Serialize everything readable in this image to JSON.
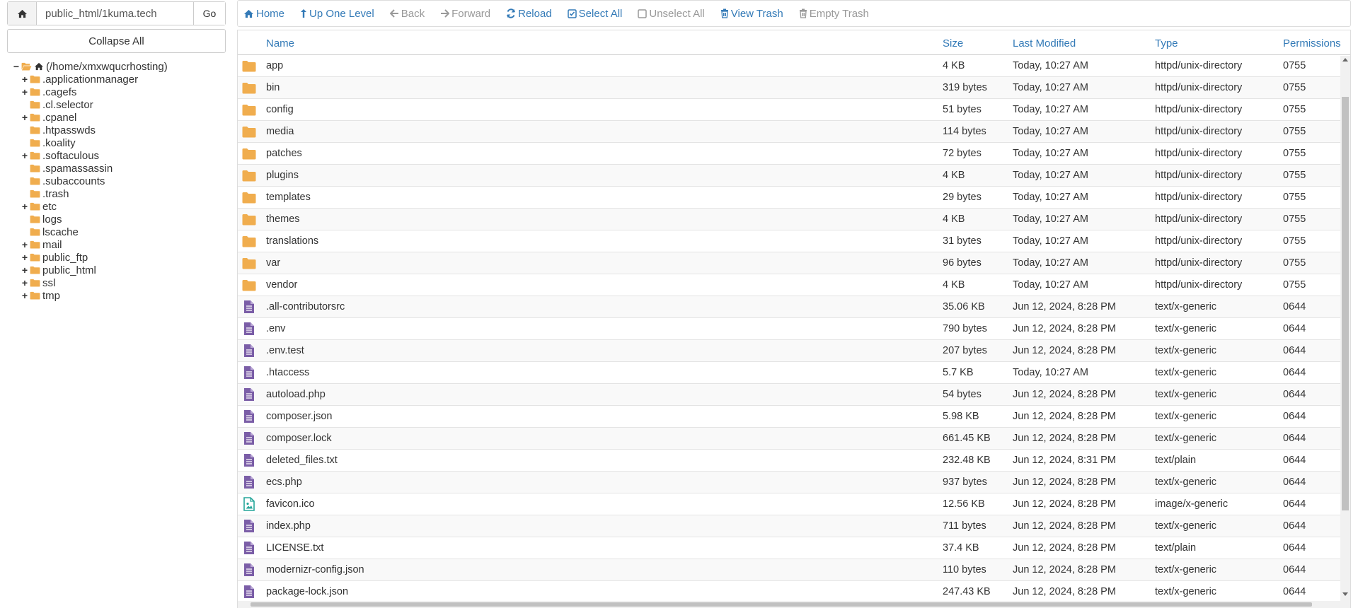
{
  "pathbar": {
    "home_icon": "home-icon",
    "path_value": "public_html/1kuma.tech",
    "go_label": "Go"
  },
  "collapse_label": "Collapse All",
  "tree": {
    "root": {
      "label": "(/home/xmxwqucrhosting)",
      "toggle": "−"
    },
    "items": [
      {
        "label": ".applicationmanager",
        "toggle": "+"
      },
      {
        "label": ".cagefs",
        "toggle": "+"
      },
      {
        "label": ".cl.selector",
        "toggle": ""
      },
      {
        "label": ".cpanel",
        "toggle": "+"
      },
      {
        "label": ".htpasswds",
        "toggle": ""
      },
      {
        "label": ".koality",
        "toggle": ""
      },
      {
        "label": ".softaculous",
        "toggle": "+"
      },
      {
        "label": ".spamassassin",
        "toggle": ""
      },
      {
        "label": ".subaccounts",
        "toggle": ""
      },
      {
        "label": ".trash",
        "toggle": ""
      },
      {
        "label": "etc",
        "toggle": "+"
      },
      {
        "label": "logs",
        "toggle": ""
      },
      {
        "label": "lscache",
        "toggle": ""
      },
      {
        "label": "mail",
        "toggle": "+"
      },
      {
        "label": "public_ftp",
        "toggle": "+"
      },
      {
        "label": "public_html",
        "toggle": "+"
      },
      {
        "label": "ssl",
        "toggle": "+"
      },
      {
        "label": "tmp",
        "toggle": "+"
      }
    ]
  },
  "toolbar": {
    "home": "Home",
    "up": "Up One Level",
    "back": "Back",
    "forward": "Forward",
    "reload": "Reload",
    "select_all": "Select All",
    "unselect_all": "Unselect All",
    "view_trash": "View Trash",
    "empty_trash": "Empty Trash"
  },
  "table": {
    "headers": {
      "name": "Name",
      "size": "Size",
      "modified": "Last Modified",
      "type": "Type",
      "perms": "Permissions"
    },
    "rows": [
      {
        "icon": "folder",
        "name": "app",
        "size": "4 KB",
        "modified": "Today, 10:27 AM",
        "type": "httpd/unix-directory",
        "perms": "0755"
      },
      {
        "icon": "folder",
        "name": "bin",
        "size": "319 bytes",
        "modified": "Today, 10:27 AM",
        "type": "httpd/unix-directory",
        "perms": "0755"
      },
      {
        "icon": "folder",
        "name": "config",
        "size": "51 bytes",
        "modified": "Today, 10:27 AM",
        "type": "httpd/unix-directory",
        "perms": "0755"
      },
      {
        "icon": "folder",
        "name": "media",
        "size": "114 bytes",
        "modified": "Today, 10:27 AM",
        "type": "httpd/unix-directory",
        "perms": "0755"
      },
      {
        "icon": "folder",
        "name": "patches",
        "size": "72 bytes",
        "modified": "Today, 10:27 AM",
        "type": "httpd/unix-directory",
        "perms": "0755"
      },
      {
        "icon": "folder",
        "name": "plugins",
        "size": "4 KB",
        "modified": "Today, 10:27 AM",
        "type": "httpd/unix-directory",
        "perms": "0755"
      },
      {
        "icon": "folder",
        "name": "templates",
        "size": "29 bytes",
        "modified": "Today, 10:27 AM",
        "type": "httpd/unix-directory",
        "perms": "0755"
      },
      {
        "icon": "folder",
        "name": "themes",
        "size": "4 KB",
        "modified": "Today, 10:27 AM",
        "type": "httpd/unix-directory",
        "perms": "0755"
      },
      {
        "icon": "folder",
        "name": "translations",
        "size": "31 bytes",
        "modified": "Today, 10:27 AM",
        "type": "httpd/unix-directory",
        "perms": "0755"
      },
      {
        "icon": "folder",
        "name": "var",
        "size": "96 bytes",
        "modified": "Today, 10:27 AM",
        "type": "httpd/unix-directory",
        "perms": "0755"
      },
      {
        "icon": "folder",
        "name": "vendor",
        "size": "4 KB",
        "modified": "Today, 10:27 AM",
        "type": "httpd/unix-directory",
        "perms": "0755"
      },
      {
        "icon": "file",
        "name": ".all-contributorsrc",
        "size": "35.06 KB",
        "modified": "Jun 12, 2024, 8:28 PM",
        "type": "text/x-generic",
        "perms": "0644"
      },
      {
        "icon": "file",
        "name": ".env",
        "size": "790 bytes",
        "modified": "Jun 12, 2024, 8:28 PM",
        "type": "text/x-generic",
        "perms": "0644"
      },
      {
        "icon": "file",
        "name": ".env.test",
        "size": "207 bytes",
        "modified": "Jun 12, 2024, 8:28 PM",
        "type": "text/x-generic",
        "perms": "0644"
      },
      {
        "icon": "file",
        "name": ".htaccess",
        "size": "5.7 KB",
        "modified": "Today, 10:27 AM",
        "type": "text/x-generic",
        "perms": "0644"
      },
      {
        "icon": "file",
        "name": "autoload.php",
        "size": "54 bytes",
        "modified": "Jun 12, 2024, 8:28 PM",
        "type": "text/x-generic",
        "perms": "0644"
      },
      {
        "icon": "file",
        "name": "composer.json",
        "size": "5.98 KB",
        "modified": "Jun 12, 2024, 8:28 PM",
        "type": "text/x-generic",
        "perms": "0644"
      },
      {
        "icon": "file",
        "name": "composer.lock",
        "size": "661.45 KB",
        "modified": "Jun 12, 2024, 8:28 PM",
        "type": "text/x-generic",
        "perms": "0644"
      },
      {
        "icon": "file",
        "name": "deleted_files.txt",
        "size": "232.48 KB",
        "modified": "Jun 12, 2024, 8:31 PM",
        "type": "text/plain",
        "perms": "0644"
      },
      {
        "icon": "file",
        "name": "ecs.php",
        "size": "937 bytes",
        "modified": "Jun 12, 2024, 8:28 PM",
        "type": "text/x-generic",
        "perms": "0644"
      },
      {
        "icon": "image",
        "name": "favicon.ico",
        "size": "12.56 KB",
        "modified": "Jun 12, 2024, 8:28 PM",
        "type": "image/x-generic",
        "perms": "0644"
      },
      {
        "icon": "file",
        "name": "index.php",
        "size": "711 bytes",
        "modified": "Jun 12, 2024, 8:28 PM",
        "type": "text/x-generic",
        "perms": "0644"
      },
      {
        "icon": "file",
        "name": "LICENSE.txt",
        "size": "37.4 KB",
        "modified": "Jun 12, 2024, 8:28 PM",
        "type": "text/plain",
        "perms": "0644"
      },
      {
        "icon": "file",
        "name": "modernizr-config.json",
        "size": "110 bytes",
        "modified": "Jun 12, 2024, 8:28 PM",
        "type": "text/x-generic",
        "perms": "0644"
      },
      {
        "icon": "file",
        "name": "package-lock.json",
        "size": "247.43 KB",
        "modified": "Jun 12, 2024, 8:28 PM",
        "type": "text/x-generic",
        "perms": "0644"
      }
    ]
  },
  "colors": {
    "link": "#337ab7",
    "folder": "#f0ad4e",
    "file": "#7b5ea7",
    "image_file": "#26a69a",
    "disabled": "#999999"
  }
}
